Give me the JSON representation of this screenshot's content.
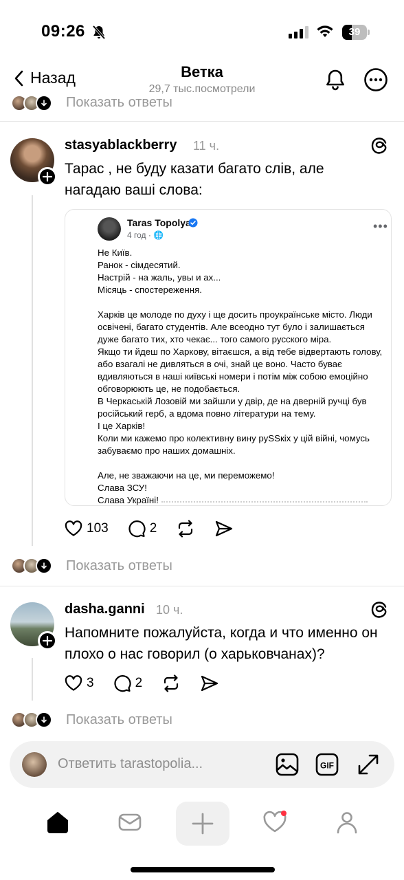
{
  "status_bar": {
    "time": "09:26",
    "battery": "39",
    "battery_level": 0.39,
    "signal_bars_active": 3,
    "signal_bars_total": 4
  },
  "nav": {
    "back_label": "Назад",
    "title": "Ветка",
    "subtitle": "29,7 тыс.посмотрели"
  },
  "top_replies": {
    "label": "Показать ответы"
  },
  "post1": {
    "username": "stasyablackberry",
    "time": "11 ч.",
    "text": "Тарас , не буду казати багато слів, але нагадаю ваші слова:",
    "likes": "103",
    "comments": "2",
    "show_replies": "Показать ответы",
    "attachment": {
      "author": "Taras Topolya",
      "meta": "4 год · 🌐",
      "body": "Не Київ.\nРанок - сімдесятий.\nНастрій - на жаль, увы и ах...\nМісяць - спостереження.\n\nХарків це молоде по духу і ще досить проукраїнське місто. Люди освічені, багато студентів. Але всеодно тут було і залишається дуже багато тих, хто чекає... того самого русского міра.\nЯкщо ти йдеш по Харкову, вітаєшся, а від тебе відвертають голову, або взагалі не дивляться в очі, знай це воно. Часто буває вдивляються в наші київські номери і потім між собою емоційно обговорюють це, не подобається.\nВ Черкаській Лозовій ми зайшли у двір, де на дверній ручці був російський герб, а вдома повно літератури на тему.\nІ це Харків!\nКоли ми кажемо про колективну вину руSSкіх у цій війні, чомусь забуваємо про наших домашніх.\n\nАле, не зважаючи на це, ми переможемо!\nСлава ЗСУ!\nСлава Україні!"
    }
  },
  "post2": {
    "username": "dasha.ganni",
    "time": "10 ч.",
    "text": "Напомните пожалуйста, когда и что именно он плохо о нас говорил (о харьковчанах)?",
    "likes": "3",
    "comments": "2",
    "show_replies": "Показать ответы"
  },
  "reply_bar": {
    "placeholder": "Ответить tarastopolia..."
  },
  "colors": {
    "muted": "#999999",
    "verified": "#1877f2",
    "notification_dot": "#ff3040"
  }
}
